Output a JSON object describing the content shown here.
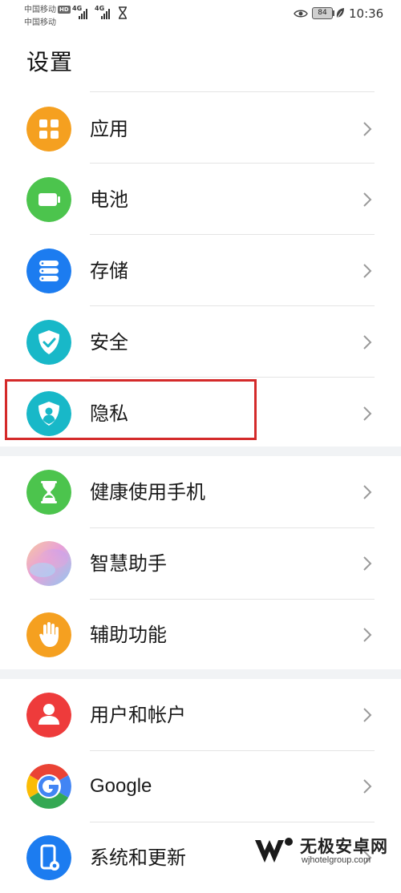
{
  "status_bar": {
    "carrier_1": "中国移动",
    "carrier_1_badge": "HD",
    "carrier_2": "中国移动",
    "network_1": "4G",
    "network_2": "4G",
    "battery_level": "84",
    "time": "10:36"
  },
  "page": {
    "title": "设置"
  },
  "groups": [
    {
      "items": [
        {
          "label": "应用",
          "icon": "apps-icon",
          "color": "#F5A020"
        },
        {
          "label": "电池",
          "icon": "battery-icon",
          "color": "#4CC44D"
        },
        {
          "label": "存储",
          "icon": "storage-icon",
          "color": "#1C7CF0"
        },
        {
          "label": "安全",
          "icon": "security-shield-icon",
          "color": "#18B8C8"
        },
        {
          "label": "隐私",
          "icon": "privacy-icon",
          "color": "#18B8C8"
        }
      ]
    },
    {
      "items": [
        {
          "label": "健康使用手机",
          "icon": "hourglass-icon",
          "color": "#4CC44D"
        },
        {
          "label": "智慧助手",
          "icon": "smart-assistant-icon",
          "color": "#C8A0E8"
        },
        {
          "label": "辅助功能",
          "icon": "hand-icon",
          "color": "#F5A020"
        }
      ]
    },
    {
      "items": [
        {
          "label": "用户和帐户",
          "icon": "user-icon",
          "color": "#EE3B3B"
        },
        {
          "label": "Google",
          "icon": "google-icon",
          "color": "#4285F4"
        },
        {
          "label": "系统和更新",
          "icon": "system-update-icon",
          "color": "#1C7CF0"
        }
      ]
    }
  ],
  "highlight": {
    "target": "隐私",
    "color": "#D42A2A"
  },
  "watermark": {
    "brand": "无极安卓网",
    "url": "wjhotelgroup.com"
  }
}
